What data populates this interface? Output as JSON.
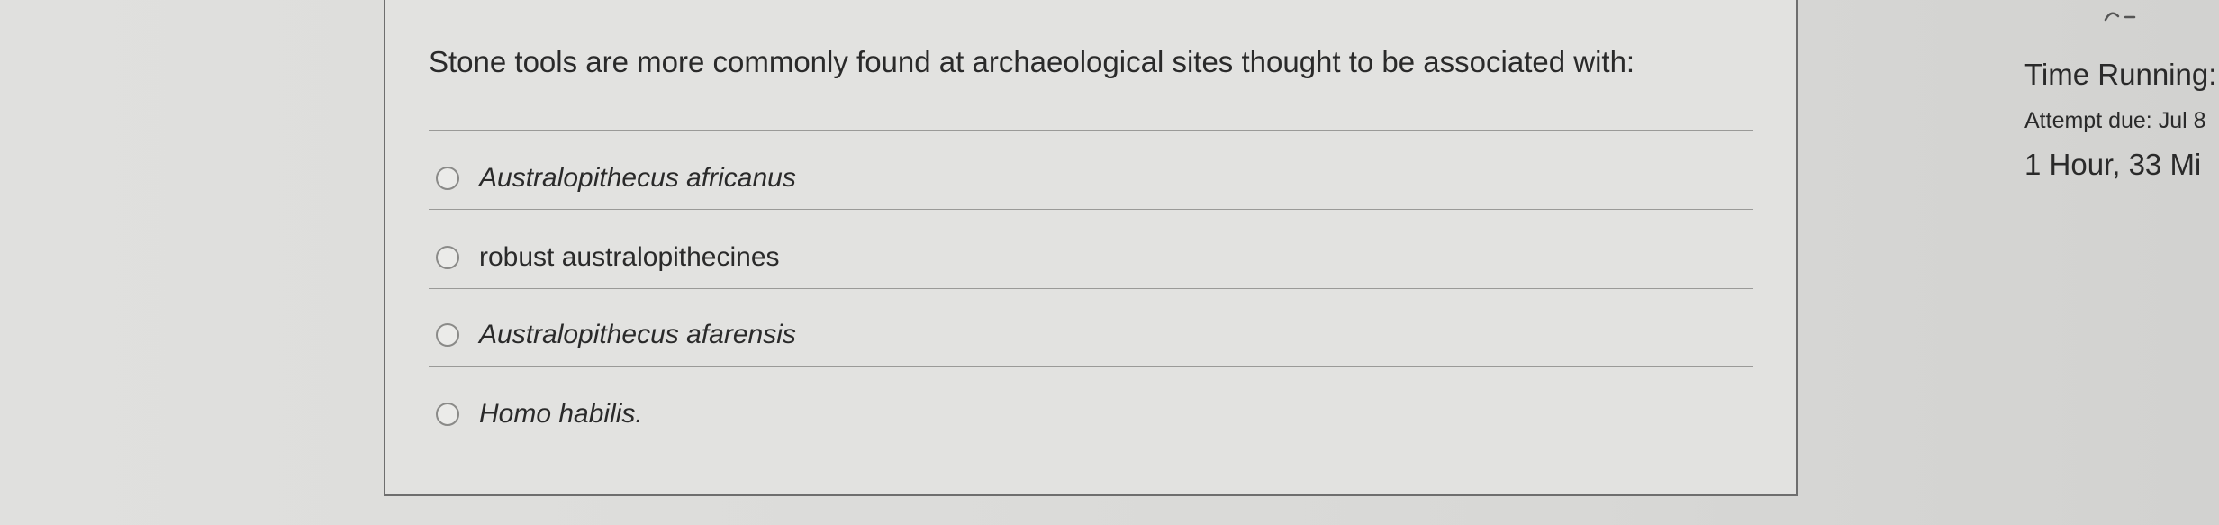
{
  "question": {
    "text": "Stone tools are more commonly found at archaeological sites thought to be associated with:",
    "options": [
      {
        "label": "Australopithecus africanus",
        "italic": true
      },
      {
        "label": "robust australopithecines",
        "italic": false
      },
      {
        "label": "Australopithecus afarensis",
        "italic": true
      },
      {
        "label": "Homo habilis.",
        "italic": true
      }
    ]
  },
  "timer": {
    "title": "Time Running:",
    "attempt_due": "Attempt due: Jul 8",
    "time_left": "1 Hour, 33 Mi"
  },
  "icons": {
    "radio": "radio-button-icon",
    "collapse": "chevron-up-icon"
  }
}
